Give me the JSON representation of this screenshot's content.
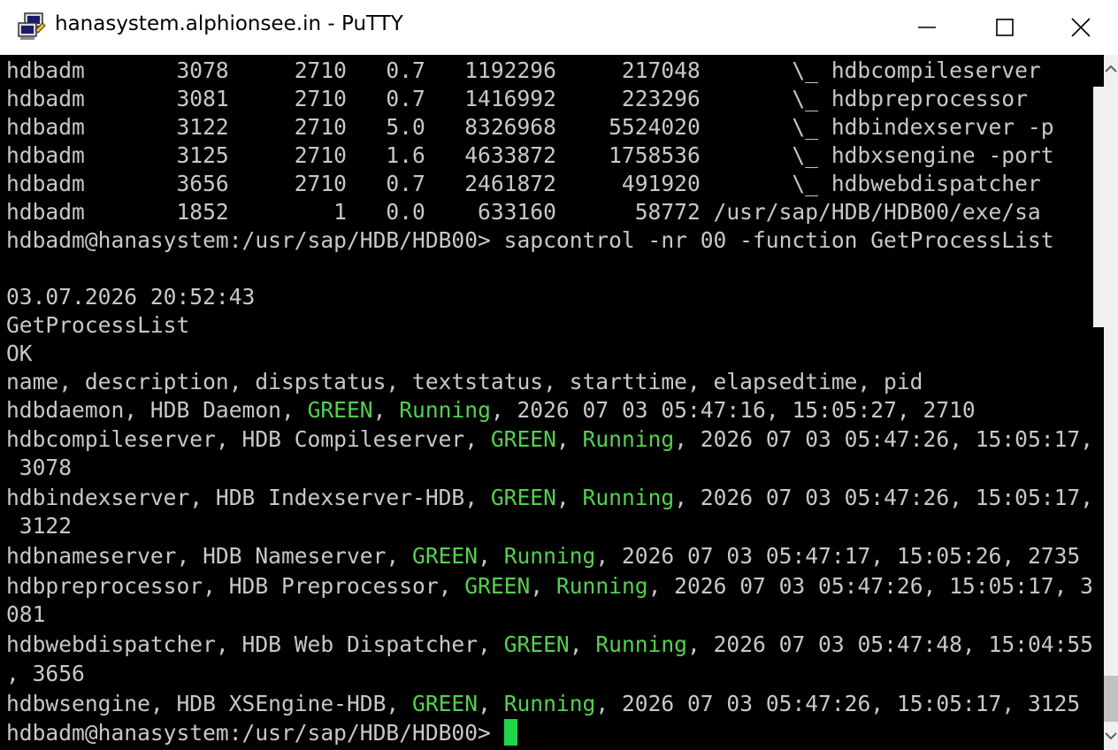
{
  "window": {
    "title": "hanasystem.alphionsee.in - PuTTY",
    "icon": "putty-icon",
    "controls": [
      "minimize-icon",
      "maximize-icon",
      "close-icon"
    ]
  },
  "colors": {
    "background": "#000000",
    "text": "#c8c8c8",
    "green": "#55d050",
    "cursor": "#1fd54a"
  },
  "terminal": {
    "lines": [
      "hdbadm       3078     2710   0.7   1192296     217048       \\_ hdbcompileserver",
      "hdbadm       3081     2710   0.7   1416992     223296       \\_ hdbpreprocessor",
      "hdbadm       3122     2710   5.0   8326968    5524020       \\_ hdbindexserver -p",
      "hdbadm       3125     2710   1.6   4633872    1758536       \\_ hdbxsengine -port",
      "hdbadm       3656     2710   0.7   2461872     491920       \\_ hdbwebdispatcher",
      "hdbadm       1852        1   0.0    633160      58772 /usr/sap/HDB/HDB00/exe/sa",
      "hdbadm@hanasystem:/usr/sap/HDB/HDB00> sapcontrol -nr 00 -function GetProcessList",
      "",
      "03.07.2026 20:52:43",
      "GetProcessList",
      "OK",
      "name, description, dispstatus, textstatus, starttime, elapsedtime, pid"
    ],
    "processes": [
      {
        "pre": "hdbdaemon, HDB Daemon, ",
        "status": "GREEN",
        "sep": ", ",
        "text": "Running",
        "post": ", 2026 07 03 05:47:16, 15:05:27, 2710",
        "cont": ""
      },
      {
        "pre": "hdbcompileserver, HDB Compileserver, ",
        "status": "GREEN",
        "sep": ", ",
        "text": "Running",
        "post": ", 2026 07 03 05:47:26, 15:05:17,",
        "cont": " 3078"
      },
      {
        "pre": "hdbindexserver, HDB Indexserver-HDB, ",
        "status": "GREEN",
        "sep": ", ",
        "text": "Running",
        "post": ", 2026 07 03 05:47:26, 15:05:17,",
        "cont": " 3122"
      },
      {
        "pre": "hdbnameserver, HDB Nameserver, ",
        "status": "GREEN",
        "sep": ", ",
        "text": "Running",
        "post": ", 2026 07 03 05:47:17, 15:05:26, 2735",
        "cont": ""
      },
      {
        "pre": "hdbpreprocessor, HDB Preprocessor, ",
        "status": "GREEN",
        "sep": ", ",
        "text": "Running",
        "post": ", 2026 07 03 05:47:26, 15:05:17, 3",
        "cont": "081"
      },
      {
        "pre": "hdbwebdispatcher, HDB Web Dispatcher, ",
        "status": "GREEN",
        "sep": ", ",
        "text": "Running",
        "post": ", 2026 07 03 05:47:48, 15:04:55",
        "cont": ", 3656"
      },
      {
        "pre": "hdbwsengine, HDB XSEngine-HDB, ",
        "status": "GREEN",
        "sep": ", ",
        "text": "Running",
        "post": ", 2026 07 03 05:47:26, 15:05:17, 3125",
        "cont": ""
      }
    ],
    "prompt": "hdbadm@hanasystem:/usr/sap/HDB/HDB00> "
  }
}
